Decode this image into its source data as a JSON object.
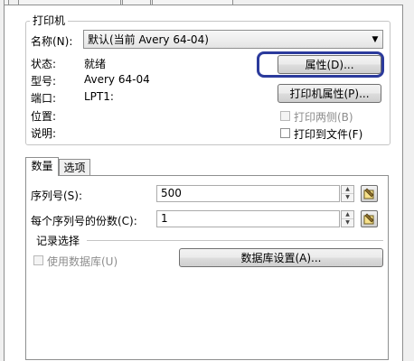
{
  "colors": {
    "highlight": "#2b3a9c",
    "panel": "#ffffff",
    "chrome": "#f0f0f0"
  },
  "printer_group": {
    "legend": "打印机",
    "name_label": "名称(N):",
    "name_value": "默认(当前 Avery 64-04)",
    "rows": [
      {
        "label": "状态:",
        "value": "就绪"
      },
      {
        "label": "型号:",
        "value": "Avery 64-04"
      },
      {
        "label": "端口:",
        "value": "LPT1:"
      },
      {
        "label": "位置:",
        "value": ""
      },
      {
        "label": "说明:",
        "value": ""
      }
    ],
    "properties_button": "属性(D)...",
    "printer_properties_button": "打印机属性(P)...",
    "duplex_checkbox": "打印两侧(B)",
    "print_to_file_checkbox": "打印到文件(F)"
  },
  "tabs": [
    "数量",
    "选项"
  ],
  "quantity": {
    "serial_label": "序列号(S):",
    "serial_value": "500",
    "copies_label": "每个序列号的份数(C):",
    "copies_value": "1"
  },
  "record_selection": {
    "legend": "记录选择",
    "use_database_checkbox": "使用数据库(U)",
    "database_settings_button": "数据库设置(A)..."
  },
  "icons": {
    "spin": "spin-arrows-icon",
    "picker": "pick-icon",
    "dropdown": "chevron-down-icon"
  }
}
